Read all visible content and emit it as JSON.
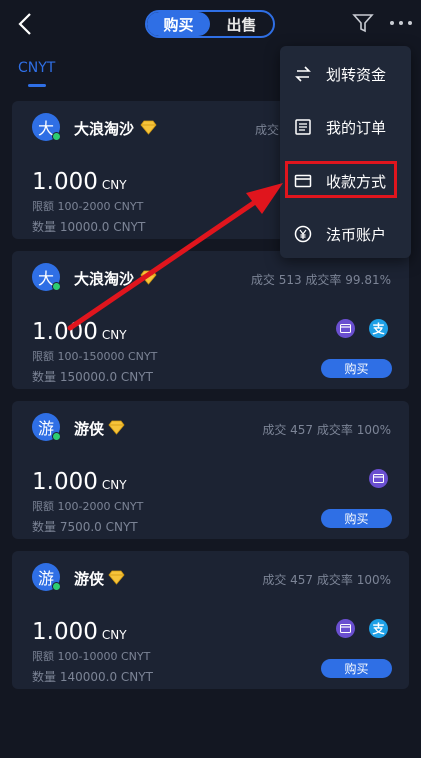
{
  "header": {
    "tabs": [
      {
        "label": "购买",
        "active": true
      },
      {
        "label": "出售",
        "active": false
      }
    ]
  },
  "currency_tab": "CNYT",
  "menu": {
    "items": [
      {
        "label": "划转资金",
        "icon": "transfer-icon"
      },
      {
        "label": "我的订单",
        "icon": "orders-icon"
      },
      {
        "label": "收款方式",
        "icon": "payment-card-icon"
      },
      {
        "label": "法币账户",
        "icon": "yuan-icon"
      }
    ]
  },
  "cards": [
    {
      "avatar": "大",
      "name": "大浪淘沙",
      "stats": "成交",
      "price": "1.000",
      "unit": "CNY",
      "limit": "限额   100-2000 CNYT",
      "qty": "数量   10000.0 CNYT",
      "payments": [],
      "buy_label": ""
    },
    {
      "avatar": "大",
      "name": "大浪淘沙",
      "stats": "成交 513  成交率 99.81%",
      "price": "1.000",
      "unit": "CNY",
      "limit": "限额   100-150000 CNYT",
      "qty": "数量   150000.0 CNYT",
      "payments": [
        "card",
        "alipay"
      ],
      "buy_label": "购买"
    },
    {
      "avatar": "游",
      "name": "游侠",
      "stats": "成交 457  成交率 100%",
      "price": "1.000",
      "unit": "CNY",
      "limit": "限额   100-2000 CNYT",
      "qty": "数量   7500.0 CNYT",
      "payments": [
        "card"
      ],
      "buy_label": "购买"
    },
    {
      "avatar": "游",
      "name": "游侠",
      "stats": "成交 457  成交率 100%",
      "price": "1.000",
      "unit": "CNY",
      "limit": "限额   100-10000 CNYT",
      "qty": "数量   140000.0 CNYT",
      "payments": [
        "card",
        "alipay"
      ],
      "buy_label": "购买"
    }
  ],
  "alipay_glyph": "支",
  "colors": {
    "background": "#131722",
    "card": "#1c2333",
    "accent": "#2f6fe5",
    "highlight": "#e0151d",
    "muted": "#7c8496"
  }
}
